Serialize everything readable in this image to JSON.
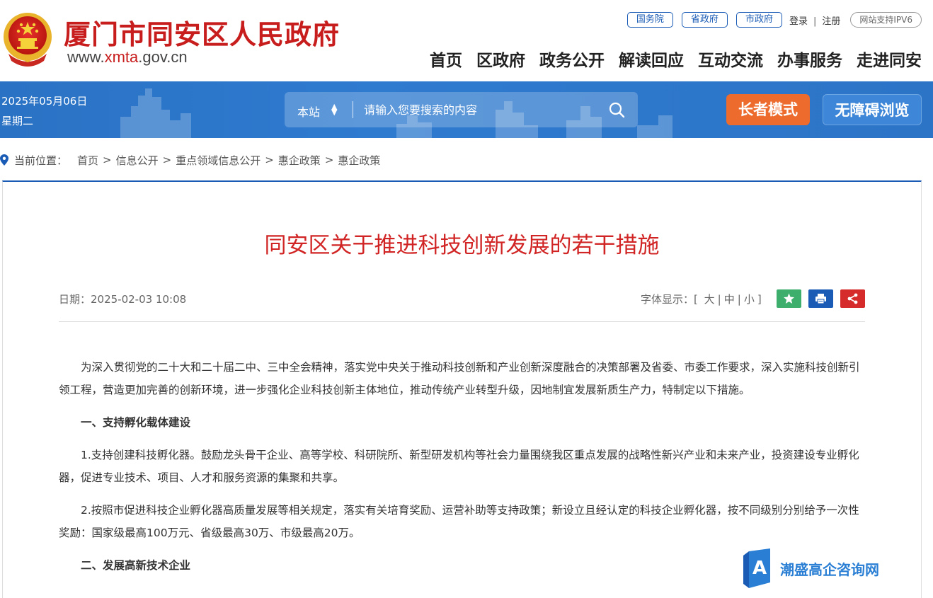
{
  "header": {
    "title": "厦门市同安区人民政府",
    "url_prefix": "www.",
    "url_highlight": "xmta",
    "url_suffix": ".gov.cn",
    "gov_links": [
      "国务院",
      "省政府",
      "市政府"
    ],
    "login": "登录",
    "separator": "|",
    "register": "注册",
    "ipv6": "网站支持IPV6",
    "nav": [
      "首页",
      "区政府",
      "政务公开",
      "解读回应",
      "互动交流",
      "办事服务",
      "走进同安"
    ]
  },
  "banner": {
    "date": "2025年05月06日",
    "weekday": "星期二",
    "search_scope": "本站",
    "search_placeholder": "请输入您要搜索的内容",
    "elder_mode": "长者模式",
    "accessibility": "无障碍浏览"
  },
  "breadcrumb": {
    "label": "当前位置：",
    "items": [
      "首页",
      "信息公开",
      "重点领域信息公开",
      "惠企政策",
      "惠企政策"
    ],
    "separator": ">"
  },
  "article": {
    "title": "同安区关于推进科技创新发展的若干措施",
    "date": "日期：2025-02-03 10:08",
    "font_label": "字体显示：",
    "bracket_open": "[",
    "bracket_close": "]",
    "font_sizes": [
      "大",
      "中",
      "小"
    ],
    "font_sep": "|",
    "paragraphs": [
      {
        "bold": false,
        "text": "为深入贯彻党的二十大和二十届二中、三中全会精神，落实党中央关于推动科技创新和产业创新深度融合的决策部署及省委、市委工作要求，深入实施科技创新引领工程，营造更加完善的创新环境，进一步强化企业科技创新主体地位，推动传统产业转型升级，因地制宜发展新质生产力，特制定以下措施。"
      },
      {
        "bold": true,
        "text": "一、支持孵化载体建设"
      },
      {
        "bold": false,
        "text": "1.支持创建科技孵化器。鼓励龙头骨干企业、高等学校、科研院所、新型研发机构等社会力量围绕我区重点发展的战略性新兴产业和未来产业，投资建设专业孵化器，促进专业技术、项目、人才和服务资源的集聚和共享。"
      },
      {
        "bold": false,
        "text": "2.按照市促进科技企业孵化器高质量发展等相关规定，落实有关培育奖励、运营补助等支持政策；新设立且经认定的科技企业孵化器，按不同级别分别给予一次性奖励：国家级最高100万元、省级最高30万、市级最高20万。"
      },
      {
        "bold": true,
        "text": "二、发展高新技术企业"
      }
    ]
  },
  "watermark": {
    "text": "潮盛高企咨询网",
    "logo_letter": "A"
  },
  "colors": {
    "brand_red": "#c81d1d",
    "brand_blue": "#1a5bb5",
    "banner_blue": "#2f7bd0",
    "elder_orange": "#ec6b2d"
  }
}
